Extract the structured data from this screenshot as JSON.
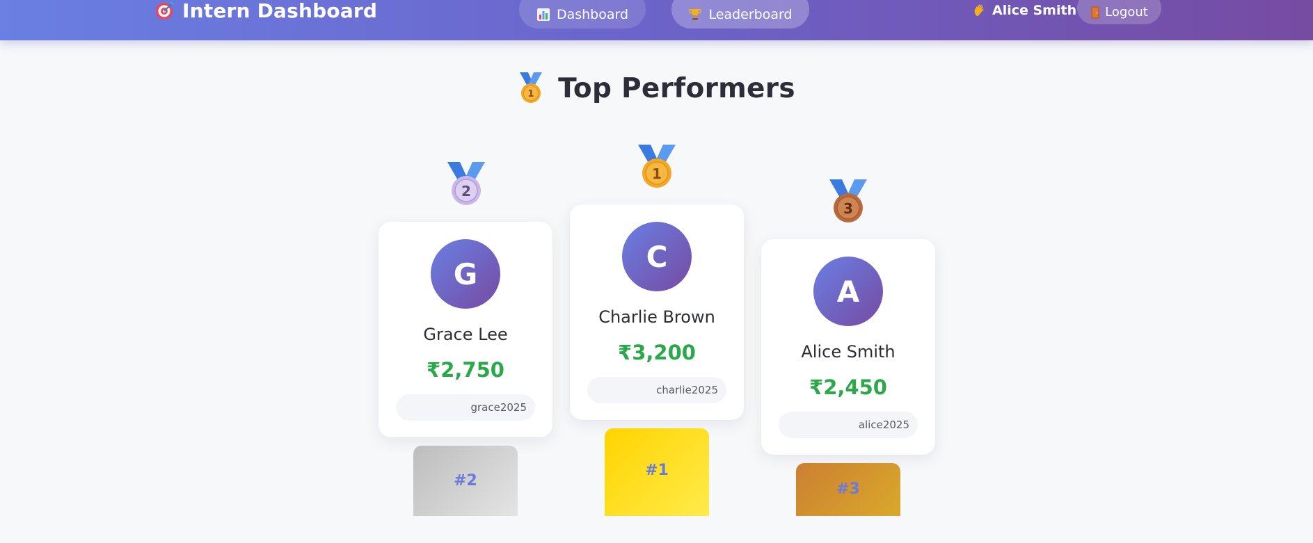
{
  "header": {
    "brand_icon": "target-icon",
    "brand_title": "Intern Dashboard",
    "nav": [
      {
        "label": "Dashboard",
        "icon": "bar-chart-icon",
        "active": false
      },
      {
        "label": "Leaderboard",
        "icon": "trophy-icon",
        "active": true
      }
    ],
    "user": {
      "icon": "waving-hand-icon",
      "name": "Alice Smith"
    },
    "logout": {
      "icon": "door-icon",
      "label": "Logout"
    },
    "colors": {
      "gradient_start": "#6a7fe3",
      "gradient_end": "#764ba2"
    }
  },
  "main": {
    "title_icon": "first-place-medal-icon",
    "title": "Top Performers"
  },
  "podium": [
    {
      "rank_label": "#2",
      "medal_text": "2",
      "initial": "G",
      "name": "Grace Lee",
      "amount": "₹2,750",
      "handle": "grace2025",
      "pedestal_color": "#c9c9c9"
    },
    {
      "rank_label": "#1",
      "medal_text": "1",
      "initial": "C",
      "name": "Charlie Brown",
      "amount": "₹3,200",
      "handle": "charlie2025",
      "pedestal_color": "#ffdd1f"
    },
    {
      "rank_label": "#3",
      "medal_text": "3",
      "initial": "A",
      "name": "Alice Smith",
      "amount": "₹2,450",
      "handle": "alice2025",
      "pedestal_color": "#d4922e"
    }
  ],
  "colors": {
    "earnings": "#2aa84a",
    "rank_text": "#6b7bd8",
    "background": "#f7f8fa"
  }
}
